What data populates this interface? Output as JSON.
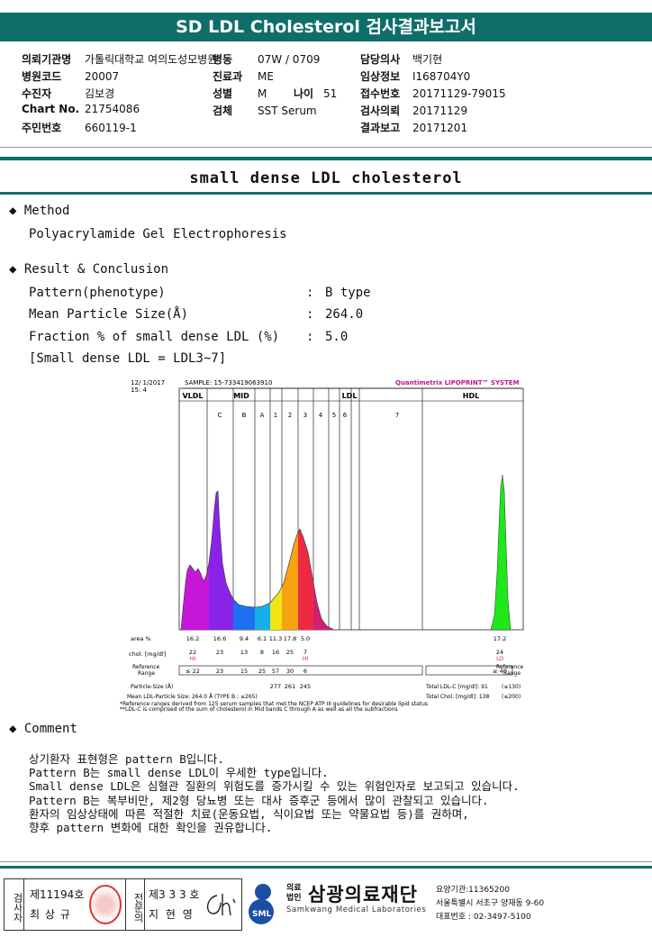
{
  "report_title": "SD LDL Cholesterol 검사결과보고서",
  "info": {
    "col1": [
      {
        "label": "의뢰기관명",
        "value": "가톨릭대학교 여의도성모병원"
      },
      {
        "label": "병원코드",
        "value": "20007"
      },
      {
        "label": "수진자",
        "value": "김보경"
      },
      {
        "label": "Chart No.",
        "value": "21754086"
      },
      {
        "label": "주민번호",
        "value": "660119-1"
      }
    ],
    "ward_label": "병동",
    "ward_value": "07W / 0709",
    "dept_label": "진료과",
    "dept_value": "ME",
    "sex_label": "성별",
    "sex_value": "M",
    "age_label": "나이",
    "age_value": "51",
    "specimen_label": "검체",
    "specimen_value": "SST Serum",
    "col3": [
      {
        "label": "담당의사",
        "value": "백기현"
      },
      {
        "label": "임상정보",
        "value": "I168704Y0"
      },
      {
        "label": "접수번호",
        "value": "20171129-79015"
      },
      {
        "label": "검사의뢰",
        "value": "20171129"
      },
      {
        "label": "결과보고",
        "value": "20171201"
      }
    ]
  },
  "sub_title": "small dense LDL cholesterol",
  "method": {
    "heading": "Method",
    "text": "Polyacrylamide Gel Electrophoresis"
  },
  "result": {
    "heading": "Result & Conclusion",
    "rows": [
      {
        "label": "Pattern(phenotype)",
        "value": "B type"
      },
      {
        "label": "Mean Particle Size(Å)",
        "value": "264.0"
      },
      {
        "label": "Fraction % of small dense LDL (%)",
        "value": "5.0"
      }
    ],
    "note": "[Small dense LDL = LDL3~7]"
  },
  "chart_data": {
    "type": "area",
    "header_left": "12/ 1/2017\n15: 4",
    "sample": "SAMPLE:  15-733419063910",
    "brand": "Quantimetrix LIPOPRINT™ SYSTEM",
    "bands": [
      "VLDL",
      "C",
      "B",
      "A",
      "1",
      "2",
      "3",
      "4",
      "5",
      "6",
      "7"
    ],
    "groups": [
      "VLDL",
      "MID",
      "LDL",
      "HDL"
    ],
    "area_pct": [
      "16.2",
      "16.6",
      "9.4",
      "6.1",
      "11.3",
      "17.8",
      "5.0",
      "",
      "",
      "",
      "",
      "17.2"
    ],
    "chol": [
      "22",
      "23",
      "13",
      "8",
      "16",
      "25",
      "7",
      "",
      "",
      "",
      "",
      "24"
    ],
    "chol_flags": {
      "VLDL": "HI",
      "3": "HI",
      "HDL": "LO"
    },
    "ref": [
      "≤ 22",
      "23",
      "15",
      "25",
      "57",
      "30",
      "6",
      "",
      "",
      "",
      "",
      "≥ 40"
    ],
    "particle_size": [
      "277",
      "261",
      "245"
    ],
    "labels": {
      "area": "area %",
      "chol": "chol. [mg/dl]",
      "ref_range": "Reference\nRange",
      "ref_range_r": "Reference\nRange",
      "particle": "Particle-Size (Å)",
      "mean_size": "Mean LDL-Particle Size:   264.0 Å  (TYPE B ; ≤265)",
      "total_ldl": "Total LDL-C [mg/dl]:  91",
      "total_ldl_ref": "(≤130)",
      "total_chol": "Total Chol.  [mg/dl]:  138",
      "total_chol_ref": "(≤200)"
    },
    "footnote1": "*Reference ranges derived from 125 serum samples that met the NCEP ATP III guidelines for desirable lipid status",
    "footnote2": "**LDL-C is comprised of the sum of cholesterol in Mid bands C through A as well as all the subfractions"
  },
  "comment": {
    "heading": "Comment",
    "text": "상기환자 표현형은 pattern B입니다.\nPattern B는 small dense LDL이 우세한 type입니다.\nSmall dense LDL은 심혈관 질환의 위험도를 증가시킬 수 있는 위험인자로 보고되고 있습니다.\nPattern B는 복부비만, 제2형 당뇨병 또는 대사 증후군 등에서 많이 관찰되고 있습니다.\n환자의 임상상태에 따른 적절한 치료(운동요법, 식이요법 또는 약물요법 등)를 권하며,\n향후 pattern 변화에 대한 확인을 권유합니다."
  },
  "footer": {
    "v1": "검사자",
    "v2": "전문의",
    "id1": "제11194호",
    "name1": "최 상 규",
    "id2": "제3 3 3 호",
    "name2": "지 현 영",
    "org_small1": "의료",
    "org_small2": "법인",
    "org_name": "삼광의료재단",
    "org_en": "Samkwang Medical Laboratories",
    "sml": "SML",
    "code": "요양기관:11365200",
    "address": "서울특별시 서초구 양재동 9-60",
    "phone": "대표번호 : 02-3497-5100"
  },
  "colors": {
    "brand": "#0f6e6a"
  }
}
